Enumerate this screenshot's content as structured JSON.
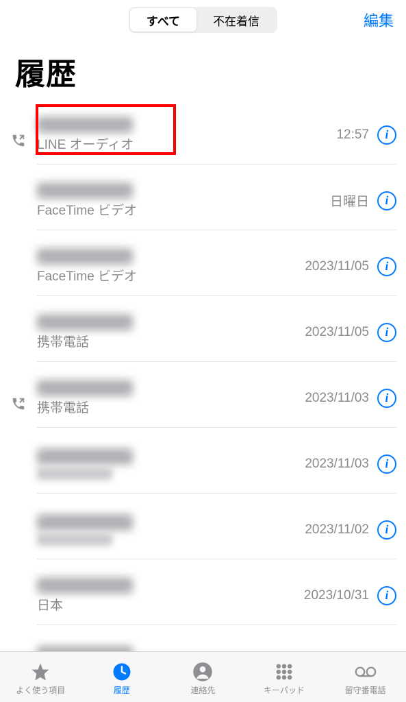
{
  "header": {
    "segment_all": "すべて",
    "segment_missed": "不在着信",
    "edit": "編集"
  },
  "title": "履歴",
  "calls": [
    {
      "name_blurred": true,
      "sub": "LINE オーディオ",
      "time": "12:57",
      "outgoing": true,
      "highlighted": true
    },
    {
      "name_blurred": true,
      "sub": "FaceTime ビデオ",
      "time": "日曜日",
      "outgoing": false
    },
    {
      "name_blurred": true,
      "sub": "FaceTime ビデオ",
      "time": "2023/11/05",
      "outgoing": false
    },
    {
      "name_blurred": true,
      "sub": "携帯電話",
      "time": "2023/11/05",
      "outgoing": false
    },
    {
      "name_blurred": true,
      "sub": "携帯電話",
      "time": "2023/11/03",
      "outgoing": true
    },
    {
      "name_blurred": true,
      "sub_blurred": true,
      "time": "2023/11/03",
      "outgoing": false
    },
    {
      "name_blurred": true,
      "sub_blurred": true,
      "time": "2023/11/02",
      "outgoing": false
    },
    {
      "name_blurred": true,
      "sub": "日本",
      "time": "2023/10/31",
      "outgoing": false
    },
    {
      "name_blurred": true,
      "sub_blurred": true,
      "time": "",
      "outgoing": true
    }
  ],
  "tabs": {
    "favorites": "よく使う項目",
    "recents": "履歴",
    "contacts": "連絡先",
    "keypad": "キーパッド",
    "voicemail": "留守番電話"
  }
}
